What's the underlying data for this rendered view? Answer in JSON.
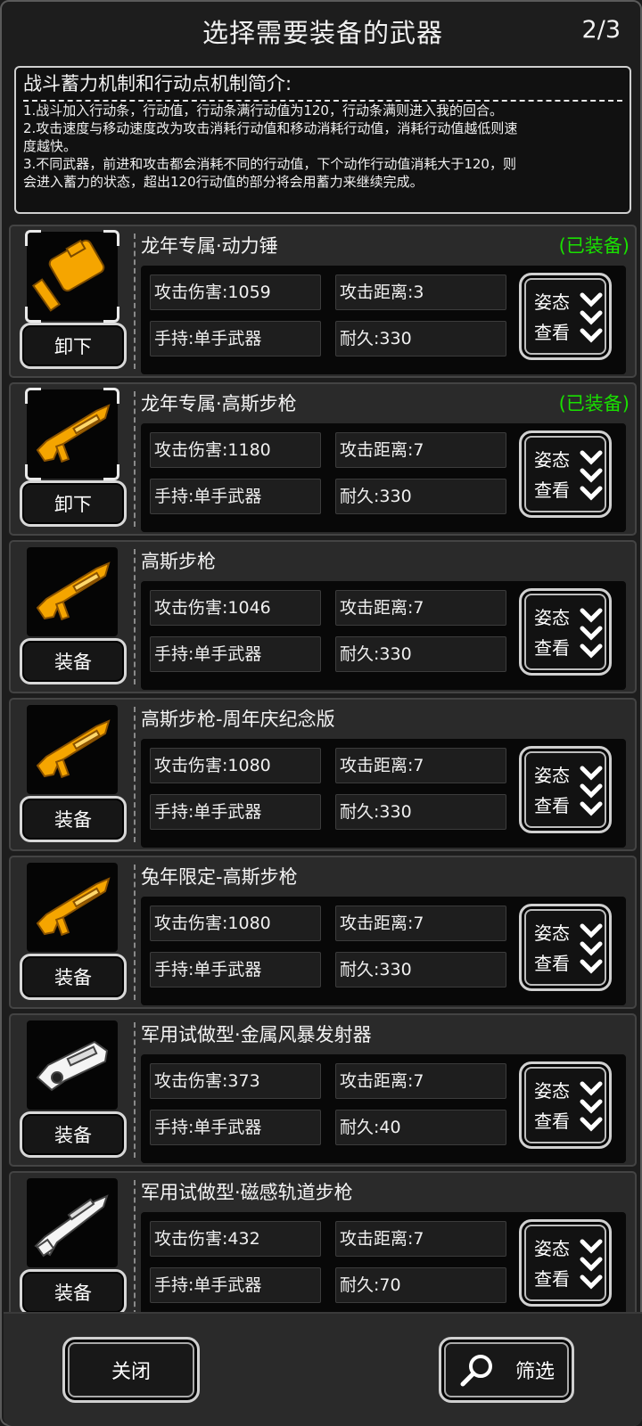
{
  "header": {
    "title": "选择需要装备的武器",
    "page": "2/3"
  },
  "intro": {
    "title": "战斗蓄力机制和行动点机制简介:",
    "lines": [
      "1.战斗加入行动条，行动值，行动条满行动值为120，行动条满则进入我的回合。",
      "2.攻击速度与移动速度改为攻击消耗行动值和移动消耗行动值，消耗行动值越低则速",
      "度越快。",
      "3.不同武器，前进和攻击都会消耗不同的行动值，下个动作行动值消耗大于120，则",
      "会进入蓄力的状态，超出120行动值的部分将会用蓄力来继续完成。"
    ]
  },
  "pose_label_1": "姿态",
  "pose_label_2": "查看",
  "weapons": [
    {
      "name": "龙年专属·动力锤",
      "status": "(已装备)",
      "action": "卸下",
      "atk": "攻击伤害:1059",
      "range": "攻击距离:3",
      "hand": "手持:单手武器",
      "dur": "耐久:330",
      "icon": "hammer-icon"
    },
    {
      "name": "龙年专属·高斯步枪",
      "status": "(已装备)",
      "action": "卸下",
      "atk": "攻击伤害:1180",
      "range": "攻击距离:7",
      "hand": "手持:单手武器",
      "dur": "耐久:330",
      "icon": "dragon-rifle-icon"
    },
    {
      "name": "高斯步枪",
      "status": "",
      "action": "装备",
      "atk": "攻击伤害:1046",
      "range": "攻击距离:7",
      "hand": "手持:单手武器",
      "dur": "耐久:330",
      "icon": "rifle-icon"
    },
    {
      "name": "高斯步枪-周年庆纪念版",
      "status": "",
      "action": "装备",
      "atk": "攻击伤害:1080",
      "range": "攻击距离:7",
      "hand": "手持:单手武器",
      "dur": "耐久:330",
      "icon": "anniversary-rifle-icon"
    },
    {
      "name": "兔年限定-高斯步枪",
      "status": "",
      "action": "装备",
      "atk": "攻击伤害:1080",
      "range": "攻击距离:7",
      "hand": "手持:单手武器",
      "dur": "耐久:330",
      "icon": "rabbit-rifle-icon"
    },
    {
      "name": "军用试做型·金属风暴发射器",
      "status": "",
      "action": "装备",
      "atk": "攻击伤害:373",
      "range": "攻击距离:7",
      "hand": "手持:单手武器",
      "dur": "耐久:40",
      "icon": "launcher-icon"
    },
    {
      "name": "军用试做型·磁感轨道步枪",
      "status": "",
      "action": "装备",
      "atk": "攻击伤害:432",
      "range": "攻击距离:7",
      "hand": "手持:单手武器",
      "dur": "耐久:70",
      "icon": "railgun-icon"
    }
  ],
  "footer": {
    "close_label": "关闭",
    "filter_label": "筛选"
  },
  "colors": {
    "equipped": "#19e000",
    "gold": "#f5a500"
  }
}
